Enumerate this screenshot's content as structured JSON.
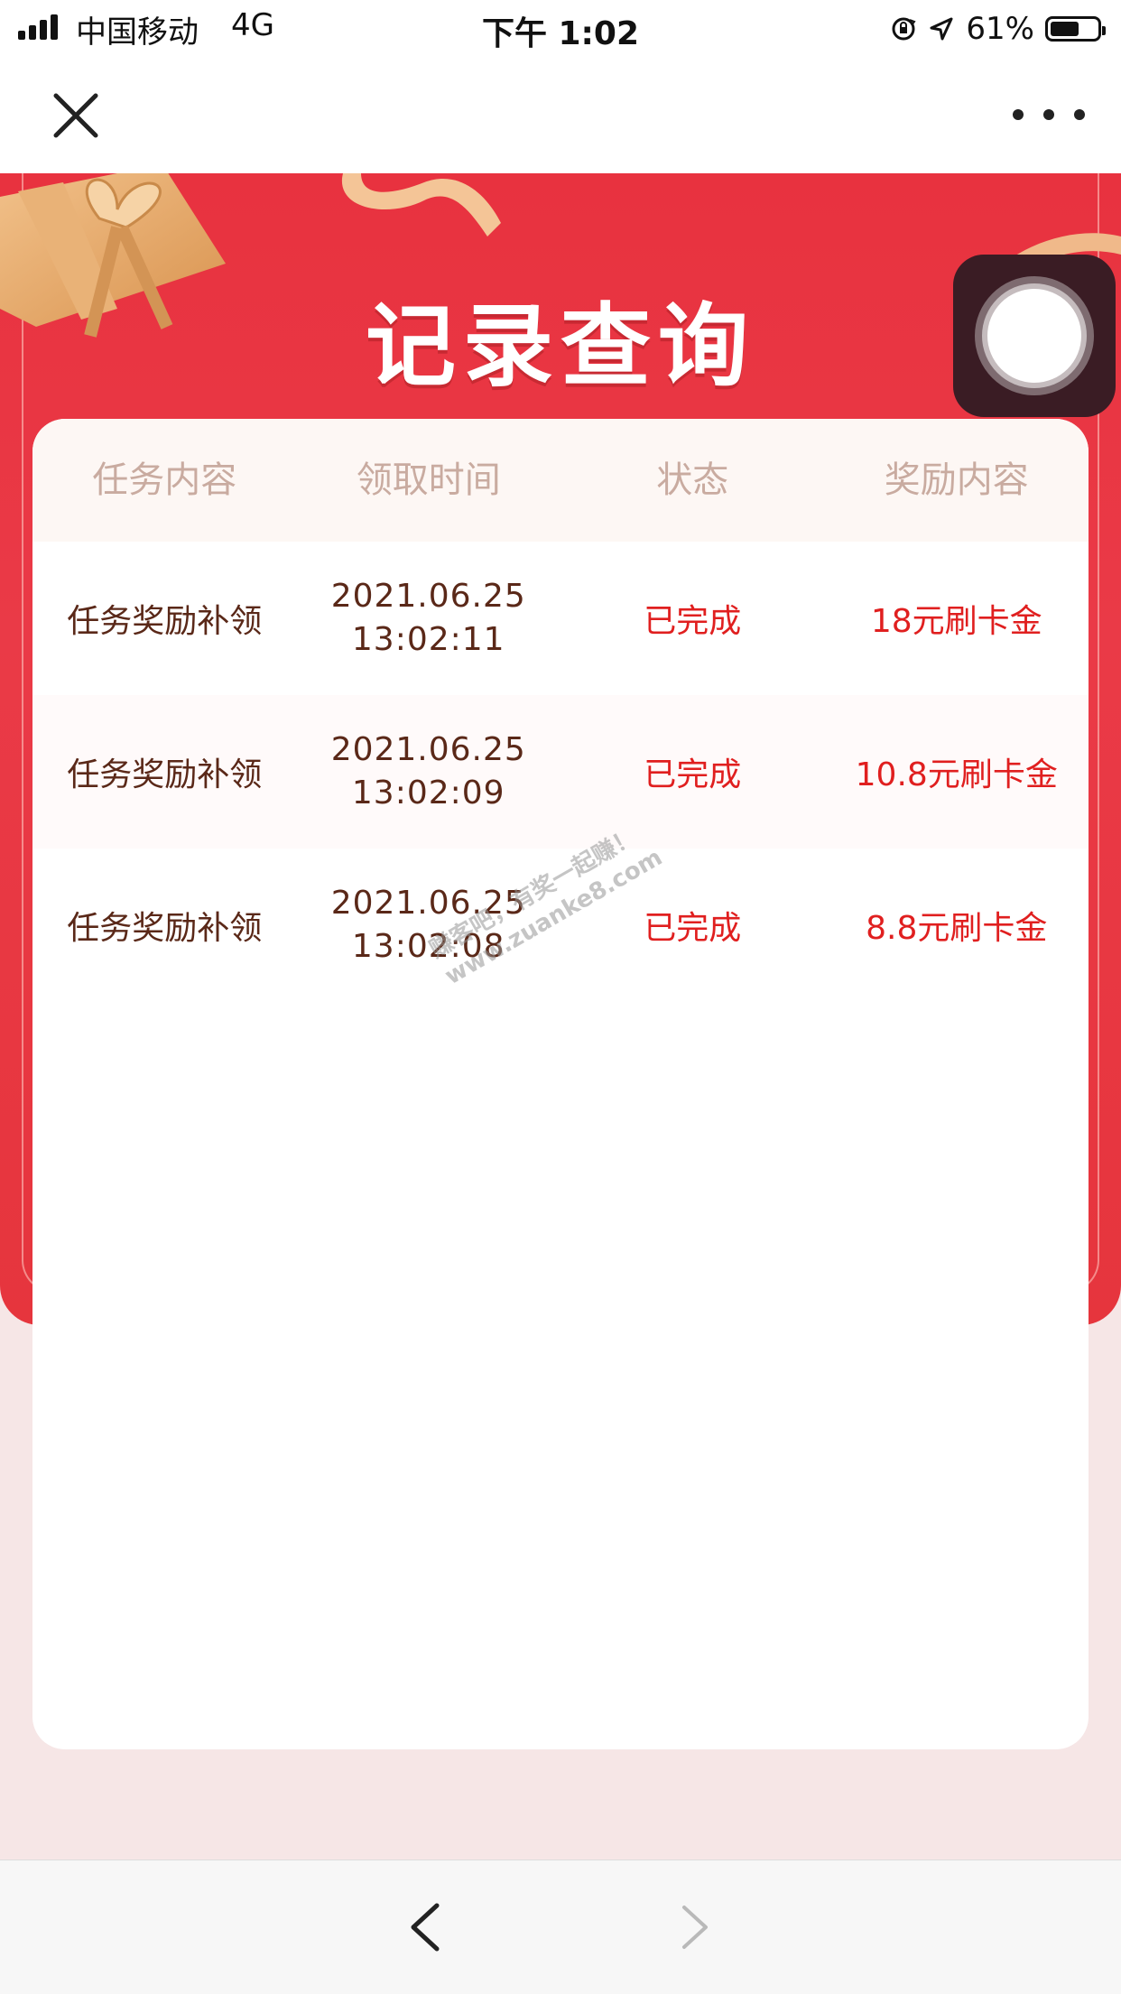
{
  "status_bar": {
    "carrier": "中国移动",
    "network": "4G",
    "time": "下午 1:02",
    "battery_percent": "61%",
    "battery_level": 0.61
  },
  "page": {
    "title": "记录查询"
  },
  "table": {
    "headers": [
      "任务内容",
      "领取时间",
      "状态",
      "奖励内容"
    ],
    "rows": [
      {
        "task": "任务奖励补领",
        "date": "2021.06.25",
        "time": "13:02:11",
        "status": "已完成",
        "reward": "18元刷卡金"
      },
      {
        "task": "任务奖励补领",
        "date": "2021.06.25",
        "time": "13:02:09",
        "status": "已完成",
        "reward": "10.8元刷卡金"
      },
      {
        "task": "任务奖励补领",
        "date": "2021.06.25",
        "time": "13:02:08",
        "status": "已完成",
        "reward": "8.8元刷卡金"
      }
    ]
  },
  "watermark": {
    "line1": "赚客吧，有奖一起赚！",
    "line2": "www.zuanke8.com"
  },
  "colors": {
    "hero_red": "#e8323f",
    "status_red": "#e01f1f",
    "header_text": "#c9aba0",
    "task_text": "#5a2818"
  },
  "icons": [
    "signal-icon",
    "orientation-lock-icon",
    "location-arrow-icon",
    "battery-icon",
    "close-icon",
    "more-icon",
    "assistive-touch-icon",
    "back-arrow-icon",
    "forward-arrow-icon"
  ]
}
